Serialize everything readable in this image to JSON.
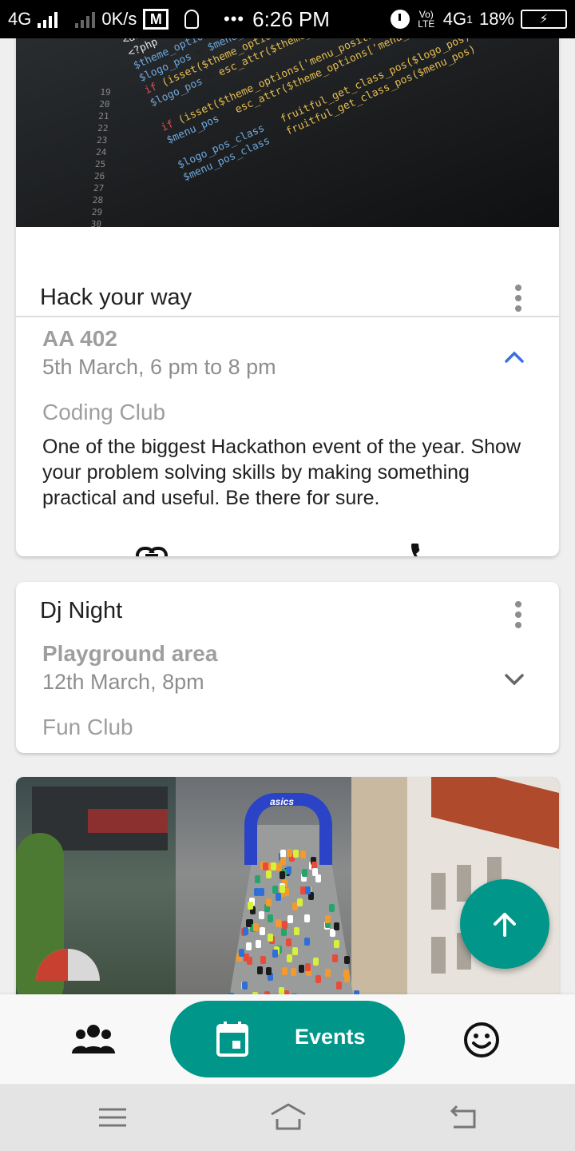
{
  "status_bar": {
    "network_left": "4G",
    "speed": "0K/s",
    "time": "6:26 PM",
    "volte": "Vo) LTE",
    "network_right": "4G",
    "sim": "1",
    "battery": "18%",
    "icons": [
      "signal-icon",
      "mail-icon",
      "bulb-icon",
      "more-dots-icon",
      "alarm-icon",
      "battery-charging-icon"
    ]
  },
  "events": [
    {
      "title": "Hack your way",
      "venue": "AA 402",
      "datetime": "5th March, 6 pm to 8 pm",
      "club": "Coding Club",
      "description": "One of the biggest Hackathon event of the year. Show your problem solving skills by making something practical and useful. Be there for sure.",
      "expanded": true,
      "actions": [
        "link-icon",
        "phone-icon"
      ]
    },
    {
      "title": "Dj Night",
      "venue": "Playground area",
      "datetime": "12th March, 8pm",
      "club": "Fun Club",
      "expanded": false
    }
  ],
  "fab": {
    "icon": "arrow-up-icon",
    "color": "#00968a"
  },
  "bottom_nav": {
    "items": [
      {
        "icon": "people-icon",
        "label": ""
      },
      {
        "icon": "calendar-icon",
        "label": "Events",
        "active": true
      },
      {
        "icon": "smiley-icon",
        "label": ""
      }
    ],
    "accent": "#00968a"
  },
  "system_nav": [
    "menu-icon",
    "home-icon",
    "back-icon"
  ]
}
